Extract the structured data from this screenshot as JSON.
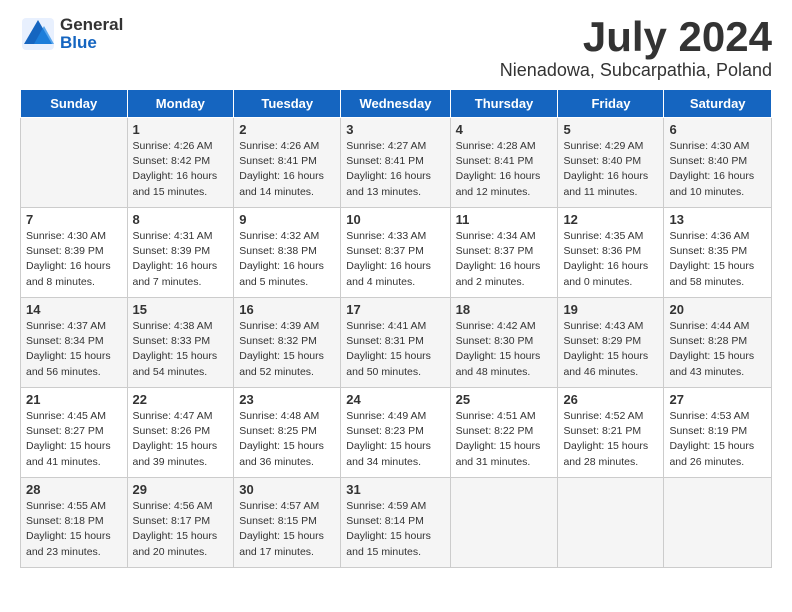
{
  "header": {
    "logo_general": "General",
    "logo_blue": "Blue",
    "month": "July 2024",
    "location": "Nienadowa, Subcarpathia, Poland"
  },
  "days_of_week": [
    "Sunday",
    "Monday",
    "Tuesday",
    "Wednesday",
    "Thursday",
    "Friday",
    "Saturday"
  ],
  "weeks": [
    [
      {
        "day": "",
        "info": ""
      },
      {
        "day": "1",
        "info": "Sunrise: 4:26 AM\nSunset: 8:42 PM\nDaylight: 16 hours\nand 15 minutes."
      },
      {
        "day": "2",
        "info": "Sunrise: 4:26 AM\nSunset: 8:41 PM\nDaylight: 16 hours\nand 14 minutes."
      },
      {
        "day": "3",
        "info": "Sunrise: 4:27 AM\nSunset: 8:41 PM\nDaylight: 16 hours\nand 13 minutes."
      },
      {
        "day": "4",
        "info": "Sunrise: 4:28 AM\nSunset: 8:41 PM\nDaylight: 16 hours\nand 12 minutes."
      },
      {
        "day": "5",
        "info": "Sunrise: 4:29 AM\nSunset: 8:40 PM\nDaylight: 16 hours\nand 11 minutes."
      },
      {
        "day": "6",
        "info": "Sunrise: 4:30 AM\nSunset: 8:40 PM\nDaylight: 16 hours\nand 10 minutes."
      }
    ],
    [
      {
        "day": "7",
        "info": "Sunrise: 4:30 AM\nSunset: 8:39 PM\nDaylight: 16 hours\nand 8 minutes."
      },
      {
        "day": "8",
        "info": "Sunrise: 4:31 AM\nSunset: 8:39 PM\nDaylight: 16 hours\nand 7 minutes."
      },
      {
        "day": "9",
        "info": "Sunrise: 4:32 AM\nSunset: 8:38 PM\nDaylight: 16 hours\nand 5 minutes."
      },
      {
        "day": "10",
        "info": "Sunrise: 4:33 AM\nSunset: 8:37 PM\nDaylight: 16 hours\nand 4 minutes."
      },
      {
        "day": "11",
        "info": "Sunrise: 4:34 AM\nSunset: 8:37 PM\nDaylight: 16 hours\nand 2 minutes."
      },
      {
        "day": "12",
        "info": "Sunrise: 4:35 AM\nSunset: 8:36 PM\nDaylight: 16 hours\nand 0 minutes."
      },
      {
        "day": "13",
        "info": "Sunrise: 4:36 AM\nSunset: 8:35 PM\nDaylight: 15 hours\nand 58 minutes."
      }
    ],
    [
      {
        "day": "14",
        "info": "Sunrise: 4:37 AM\nSunset: 8:34 PM\nDaylight: 15 hours\nand 56 minutes."
      },
      {
        "day": "15",
        "info": "Sunrise: 4:38 AM\nSunset: 8:33 PM\nDaylight: 15 hours\nand 54 minutes."
      },
      {
        "day": "16",
        "info": "Sunrise: 4:39 AM\nSunset: 8:32 PM\nDaylight: 15 hours\nand 52 minutes."
      },
      {
        "day": "17",
        "info": "Sunrise: 4:41 AM\nSunset: 8:31 PM\nDaylight: 15 hours\nand 50 minutes."
      },
      {
        "day": "18",
        "info": "Sunrise: 4:42 AM\nSunset: 8:30 PM\nDaylight: 15 hours\nand 48 minutes."
      },
      {
        "day": "19",
        "info": "Sunrise: 4:43 AM\nSunset: 8:29 PM\nDaylight: 15 hours\nand 46 minutes."
      },
      {
        "day": "20",
        "info": "Sunrise: 4:44 AM\nSunset: 8:28 PM\nDaylight: 15 hours\nand 43 minutes."
      }
    ],
    [
      {
        "day": "21",
        "info": "Sunrise: 4:45 AM\nSunset: 8:27 PM\nDaylight: 15 hours\nand 41 minutes."
      },
      {
        "day": "22",
        "info": "Sunrise: 4:47 AM\nSunset: 8:26 PM\nDaylight: 15 hours\nand 39 minutes."
      },
      {
        "day": "23",
        "info": "Sunrise: 4:48 AM\nSunset: 8:25 PM\nDaylight: 15 hours\nand 36 minutes."
      },
      {
        "day": "24",
        "info": "Sunrise: 4:49 AM\nSunset: 8:23 PM\nDaylight: 15 hours\nand 34 minutes."
      },
      {
        "day": "25",
        "info": "Sunrise: 4:51 AM\nSunset: 8:22 PM\nDaylight: 15 hours\nand 31 minutes."
      },
      {
        "day": "26",
        "info": "Sunrise: 4:52 AM\nSunset: 8:21 PM\nDaylight: 15 hours\nand 28 minutes."
      },
      {
        "day": "27",
        "info": "Sunrise: 4:53 AM\nSunset: 8:19 PM\nDaylight: 15 hours\nand 26 minutes."
      }
    ],
    [
      {
        "day": "28",
        "info": "Sunrise: 4:55 AM\nSunset: 8:18 PM\nDaylight: 15 hours\nand 23 minutes."
      },
      {
        "day": "29",
        "info": "Sunrise: 4:56 AM\nSunset: 8:17 PM\nDaylight: 15 hours\nand 20 minutes."
      },
      {
        "day": "30",
        "info": "Sunrise: 4:57 AM\nSunset: 8:15 PM\nDaylight: 15 hours\nand 17 minutes."
      },
      {
        "day": "31",
        "info": "Sunrise: 4:59 AM\nSunset: 8:14 PM\nDaylight: 15 hours\nand 15 minutes."
      },
      {
        "day": "",
        "info": ""
      },
      {
        "day": "",
        "info": ""
      },
      {
        "day": "",
        "info": ""
      }
    ]
  ]
}
